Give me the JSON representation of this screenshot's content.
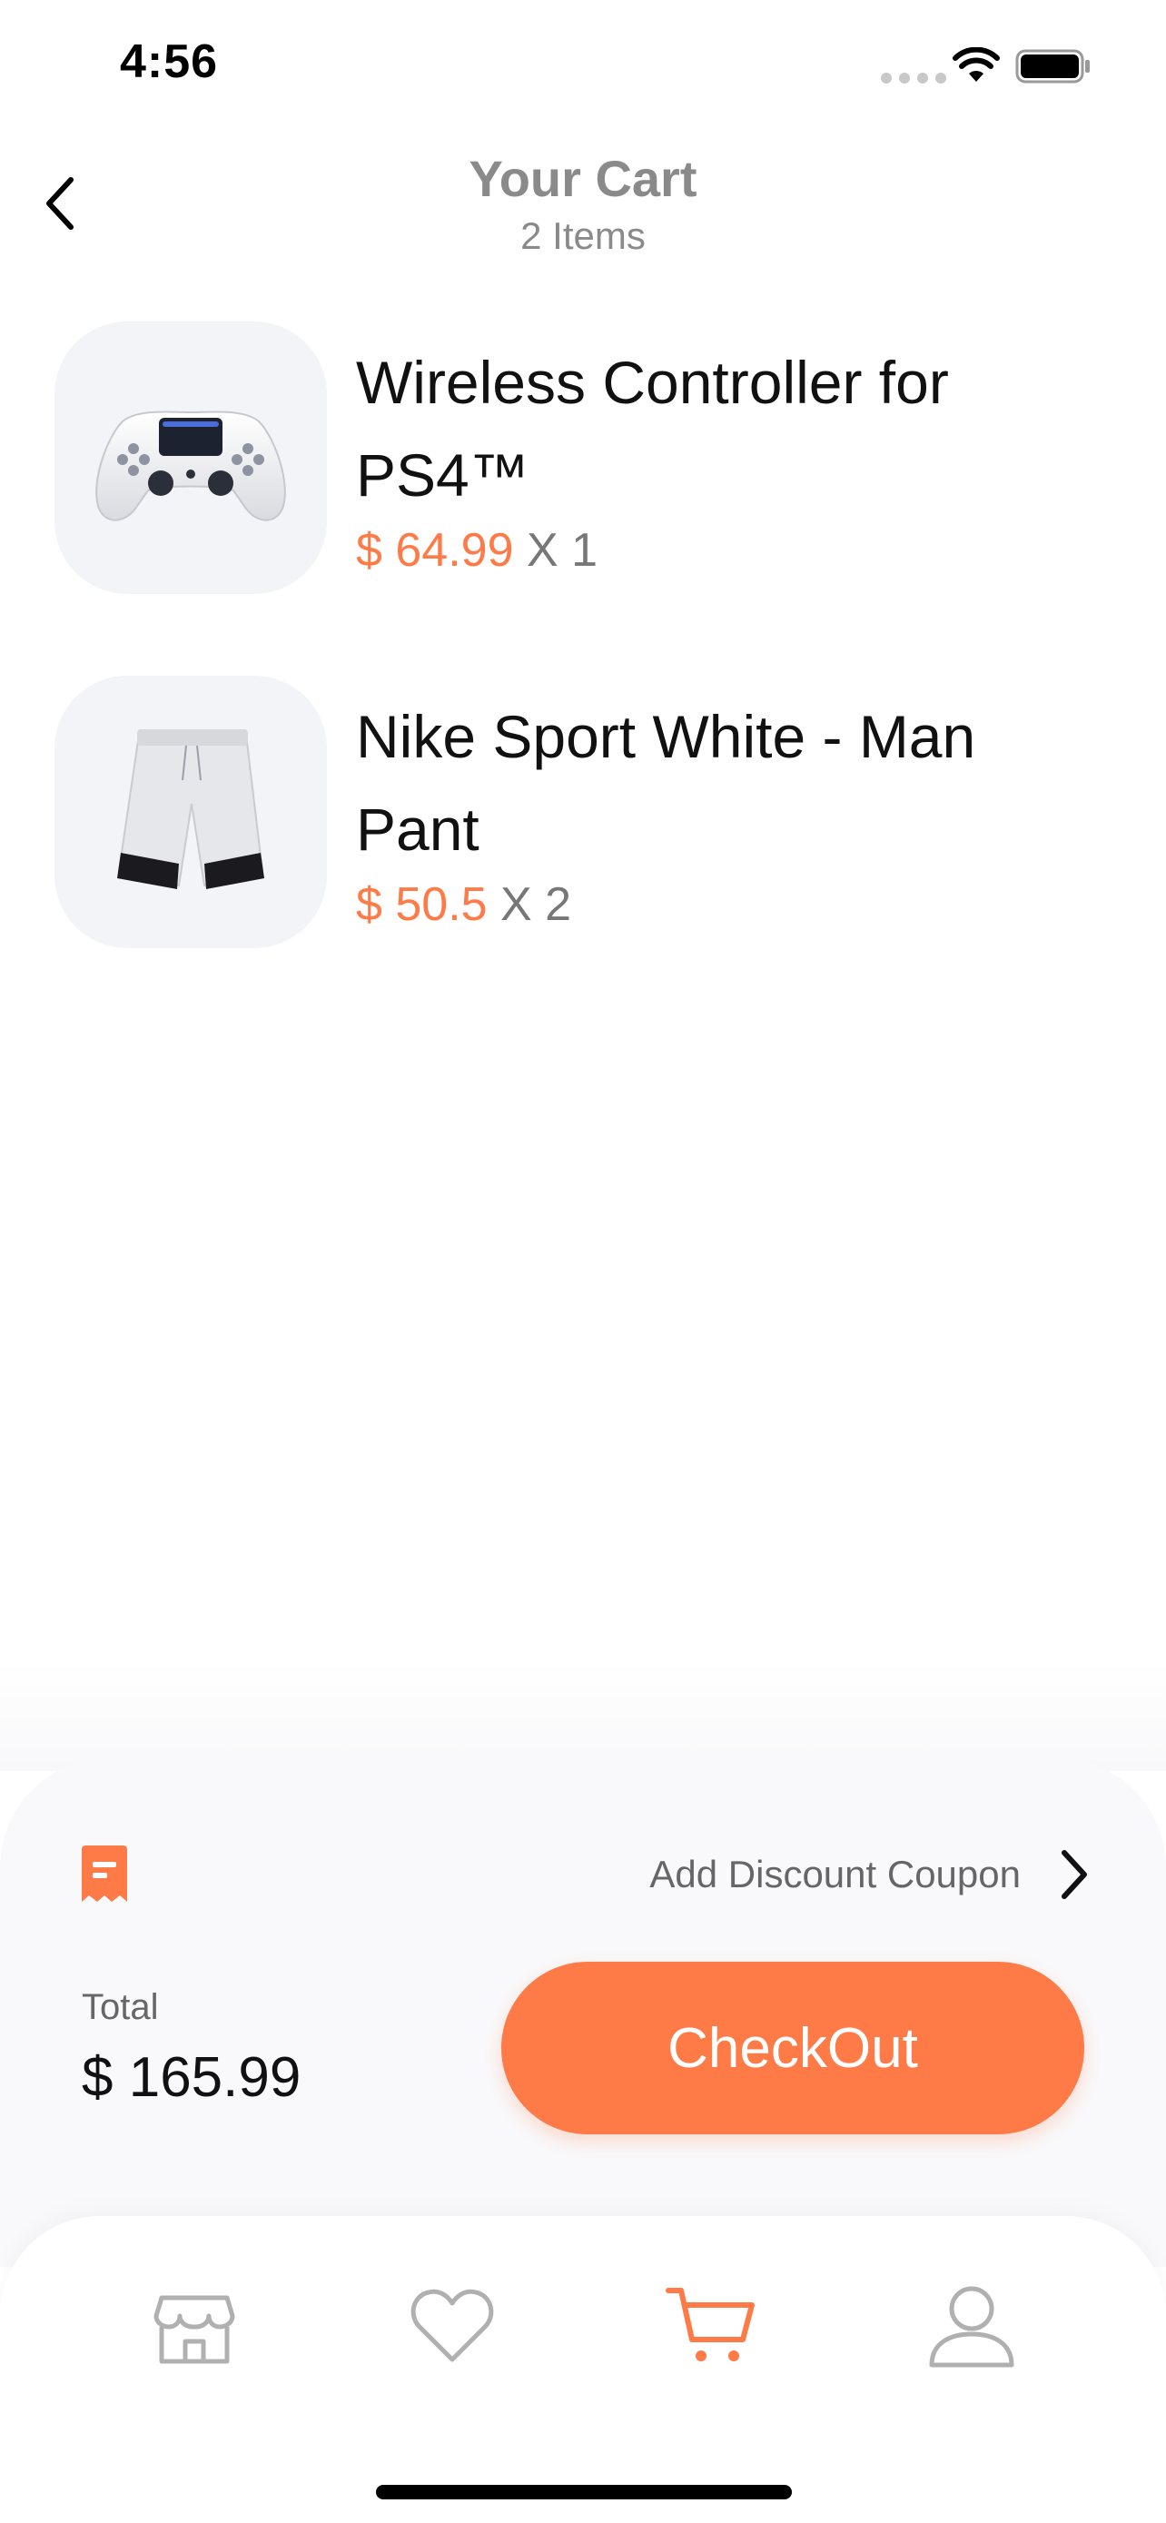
{
  "status_bar": {
    "time": "4:56",
    "icons": [
      "signal-icon",
      "wifi-icon",
      "battery-icon"
    ]
  },
  "header": {
    "back_icon": "chevron-left-icon",
    "title": "Your Cart",
    "subtitle": "2 Items"
  },
  "cart": {
    "items": [
      {
        "name": "Wireless Controller for PS4™",
        "price": "$ 64.99",
        "quantity": "X 1",
        "image": "game-controller"
      },
      {
        "name": "Nike Sport White - Man Pant",
        "price": "$ 50.5",
        "quantity": "X 2",
        "image": "sport-shorts"
      }
    ]
  },
  "checkout": {
    "coupon_icon": "receipt-icon",
    "coupon_label": "Add Discount Coupon",
    "coupon_chevron": "chevron-right-icon",
    "total_label": "Total",
    "total_value": "$ 165.99",
    "button_label": "CheckOut"
  },
  "tab_bar": {
    "tabs": [
      {
        "icon": "shop-icon",
        "active": false
      },
      {
        "icon": "heart-icon",
        "active": false
      },
      {
        "icon": "cart-icon",
        "active": true
      },
      {
        "icon": "user-icon",
        "active": false
      }
    ]
  },
  "colors": {
    "accent": "#fe7a47",
    "muted_text": "#8a8a8a",
    "thumb_bg": "#f3f4f8",
    "inactive_icon": "#b0b0b0"
  }
}
